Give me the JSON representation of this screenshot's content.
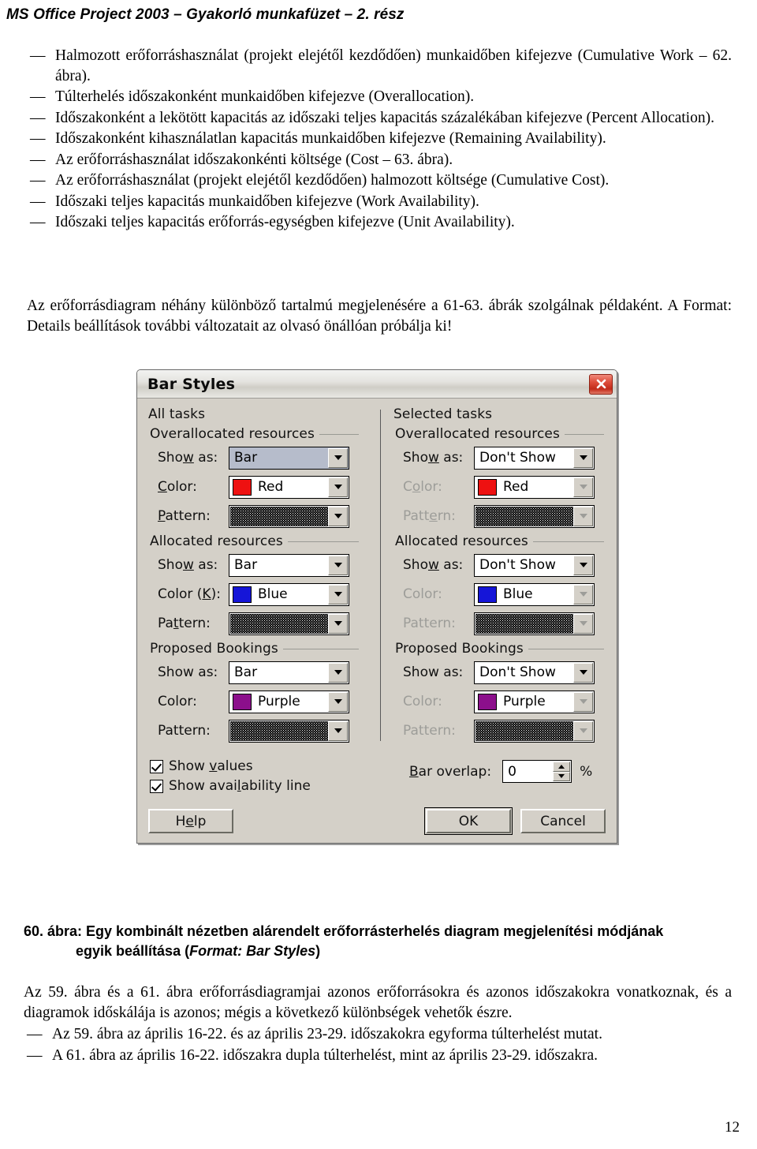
{
  "header": {
    "running_title": "MS Office Project 2003 – Gyakorló munkafüzet – 2. rész"
  },
  "body": {
    "bullets_top": [
      "Halmozott erőforráshasználat (projekt elejétől kezdődően) munkaidőben kifejezve (Cumulative Work – 62. ábra).",
      "Túlterhelés időszakonként munkaidőben kifejezve (Overallocation).",
      "Időszakonként a lekötött kapacitás az időszaki teljes kapacitás százalékában kifejezve (Percent Allocation).",
      "Időszakonként kihasználatlan kapacitás munkaidőben kifejezve (Remaining Availability).",
      "Az erőforráshasználat időszakonkénti költsége (Cost – 63. ábra).",
      "Az erőforráshasználat (projekt elejétől kezdődően) halmozott költsége (Cumulative Cost).",
      "Időszaki teljes kapacitás munkaidőben kifejezve (Work Availability).",
      "Időszaki teljes kapacitás erőforrás-egységben kifejezve (Unit Availability)."
    ],
    "paragraph_top": "Az erőforrásdiagram néhány különböző tartalmú megjelenésére a 61-63. ábrák szolgálnak példaként. A Format: Details beállítások további változatait az olvasó önállóan próbálja ki!",
    "paragraph_bottom": "Az 59. ábra és a 61. ábra erőforrásdiagramjai azonos erőforrásokra és azonos időszakokra vonatkoznak, és a diagramok időskálája is azonos; mégis a következő különbségek vehetők észre.",
    "bullets_bottom": [
      "Az 59. ábra az április 16-22. és az április 23-29. időszakokra egyforma túlterhelést mutat.",
      "A 61. ábra az április 16-22. időszakra dupla túlterhelést, mint az április 23-29. időszakra."
    ],
    "dash": "—"
  },
  "dialog": {
    "title": "Bar Styles",
    "close_icon": "close-icon",
    "left": {
      "heading": "All tasks",
      "groups": [
        {
          "title": "Overallocated resources",
          "show_as_label": "Show as:",
          "show_as_label_pre": "Sho",
          "show_as_label_accel": "w",
          "show_as_label_post": " as:",
          "show_as_value": "Bar",
          "color_label": "Color:",
          "color_label_pre": "",
          "color_label_accel": "C",
          "color_label_post": "olor:",
          "color_value": "Red",
          "color_hex": "#ee1111",
          "pattern_label": "Pattern:",
          "pattern_label_pre": "",
          "pattern_label_accel": "P",
          "pattern_label_post": "attern:"
        },
        {
          "title": "Allocated resources",
          "show_as_label": "Show as:",
          "show_as_label_pre": "Sho",
          "show_as_label_accel": "w",
          "show_as_label_post": " as:",
          "show_as_value": "Bar",
          "color_label": "Color (K):",
          "color_label_pre": "Color (",
          "color_label_accel": "K",
          "color_label_post": "):",
          "color_value": "Blue",
          "color_hex": "#1515d8",
          "pattern_label": "Pattern:",
          "pattern_label_pre": "Pa",
          "pattern_label_accel": "t",
          "pattern_label_post": "tern:"
        },
        {
          "title": "Proposed Bookings",
          "show_as_label": "Show as:",
          "show_as_label_pre": "Show as:",
          "show_as_label_accel": "",
          "show_as_label_post": "",
          "show_as_value": "Bar",
          "color_label": "Color:",
          "color_label_pre": "Color:",
          "color_label_accel": "",
          "color_label_post": "",
          "color_value": "Purple",
          "color_hex": "#8c0f8c",
          "pattern_label": "Pattern:",
          "pattern_label_pre": "Pattern:",
          "pattern_label_accel": "",
          "pattern_label_post": ""
        }
      ]
    },
    "right": {
      "heading": "Selected tasks",
      "groups": [
        {
          "title": "Overallocated resources",
          "show_as_label": "Show as:",
          "show_as_label_pre": "Sho",
          "show_as_label_accel": "w",
          "show_as_label_post": " as:",
          "show_as_value": "Don't Show",
          "color_label": "Color:",
          "color_label_pre": "C",
          "color_label_accel": "o",
          "color_label_post": "lor:",
          "color_value": "Red",
          "color_hex": "#ee1111",
          "pattern_label": "Pattern:",
          "pattern_label_pre": "Patt",
          "pattern_label_accel": "e",
          "pattern_label_post": "rn:"
        },
        {
          "title": "Allocated resources",
          "show_as_label": "Show as:",
          "show_as_label_pre": "Sho",
          "show_as_label_accel": "w",
          "show_as_label_post": " as:",
          "show_as_value": "Don't Show",
          "color_label": "Color:",
          "color_label_pre": "Color:",
          "color_label_accel": "",
          "color_label_post": "",
          "color_value": "Blue",
          "color_hex": "#1515d8",
          "pattern_label": "Pattern:",
          "pattern_label_pre": "Pattern:",
          "pattern_label_accel": "",
          "pattern_label_post": ""
        },
        {
          "title": "Proposed Bookings",
          "show_as_label": "Show as:",
          "show_as_label_pre": "Show as:",
          "show_as_label_accel": "",
          "show_as_label_post": "",
          "show_as_value": "Don't Show",
          "color_label": "Color:",
          "color_label_pre": "Color:",
          "color_label_accel": "",
          "color_label_post": "",
          "color_value": "Purple",
          "color_hex": "#8c0f8c",
          "pattern_label": "Pattern:",
          "pattern_label_pre": "Pattern:",
          "pattern_label_accel": "",
          "pattern_label_post": ""
        }
      ]
    },
    "checkboxes": [
      {
        "label": "Show values",
        "pre": "Show ",
        "accel": "v",
        "post": "alues",
        "checked": true
      },
      {
        "label": "Show availability line",
        "pre": "Show avai",
        "accel": "l",
        "post": "ability line",
        "checked": true
      }
    ],
    "bar_overlap": {
      "label": "Bar overlap:",
      "label_pre": "",
      "label_accel": "B",
      "label_post": "ar overlap:",
      "value": "0",
      "unit": "%"
    },
    "buttons": {
      "help": "Help",
      "help_pre": "H",
      "help_accel": "e",
      "help_post": "lp",
      "ok": "OK",
      "cancel": "Cancel"
    }
  },
  "figure_caption": {
    "line1": "60. ábra: Egy kombinált nézetben alárendelt erőforrásterhelés diagram megjelenítési módjának",
    "line2_pre": "egyik beállítása (",
    "line2_italic": "Format: Bar Styles",
    "line2_post": ")"
  },
  "page_number": "12"
}
